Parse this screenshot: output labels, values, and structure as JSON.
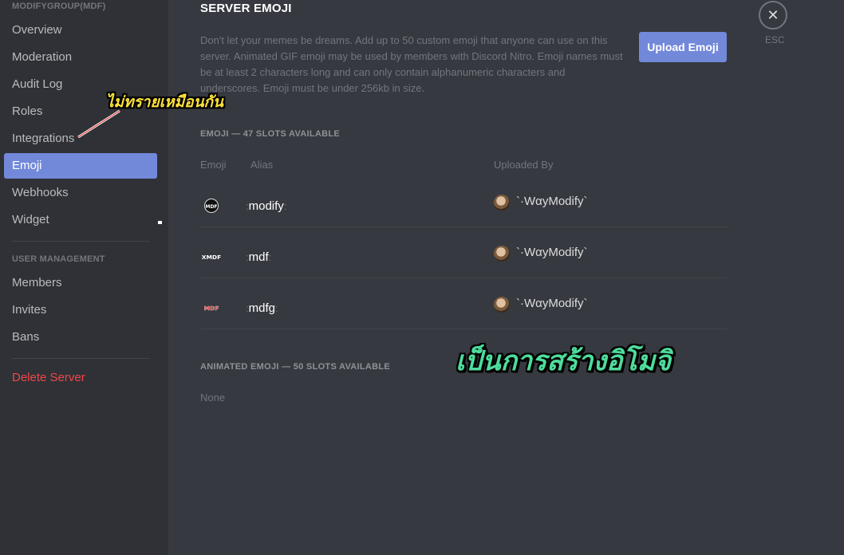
{
  "sidebar": {
    "server_header": "MODIFYGROUP(MDF)",
    "items": [
      {
        "label": "Overview"
      },
      {
        "label": "Moderation"
      },
      {
        "label": "Audit Log"
      },
      {
        "label": "Roles"
      },
      {
        "label": "Integrations"
      },
      {
        "label": "Emoji",
        "active": true
      },
      {
        "label": "Webhooks"
      },
      {
        "label": "Widget"
      }
    ],
    "user_management_header": "USER MANAGEMENT",
    "user_items": [
      {
        "label": "Members"
      },
      {
        "label": "Invites"
      },
      {
        "label": "Bans"
      }
    ],
    "delete_label": "Delete Server"
  },
  "main": {
    "title": "SERVER EMOJI",
    "description": "Don't let your memes be dreams. Add up to 50 custom emoji that anyone can use on this server. Animated GIF emoji may be used by members with Discord Nitro. Emoji names must be at least 2 characters long and can only contain alphanumeric characters and underscores. Emoji must be under 256kb in size.",
    "upload_button": "Upload Emoji",
    "close_icon": "close-icon",
    "esc_label": "ESC",
    "emoji_section": "EMOJI — 47 SLOTS AVAILABLE",
    "columns": {
      "emoji": "Emoji",
      "alias": "Alias",
      "uploaded_by": "Uploaded By"
    },
    "emoji_rows": [
      {
        "image_text": "MDF",
        "alias": "modify",
        "uploader": "`·WαyModify`"
      },
      {
        "image_text": "XMDF",
        "alias": "mdf",
        "uploader": "`·WαyModify`"
      },
      {
        "image_text": "MDF",
        "alias": "mdfg",
        "uploader": "`·WαyModify`"
      }
    ],
    "colon": ":",
    "animated_section": "ANIMATED EMOJI — 50 SLOTS AVAILABLE",
    "animated_none": "None"
  },
  "annotations": {
    "note_top": "ไม่ทรายเหมือนกัน",
    "note_center": "เป็นการสร้างอิโมจิ",
    "note_top_color": "#ffe23a",
    "note_center_color": "#4ddc9c"
  },
  "colors": {
    "accent": "#7289da",
    "danger": "#f04747",
    "background": "#36393f",
    "sidebar": "#2f3136"
  }
}
